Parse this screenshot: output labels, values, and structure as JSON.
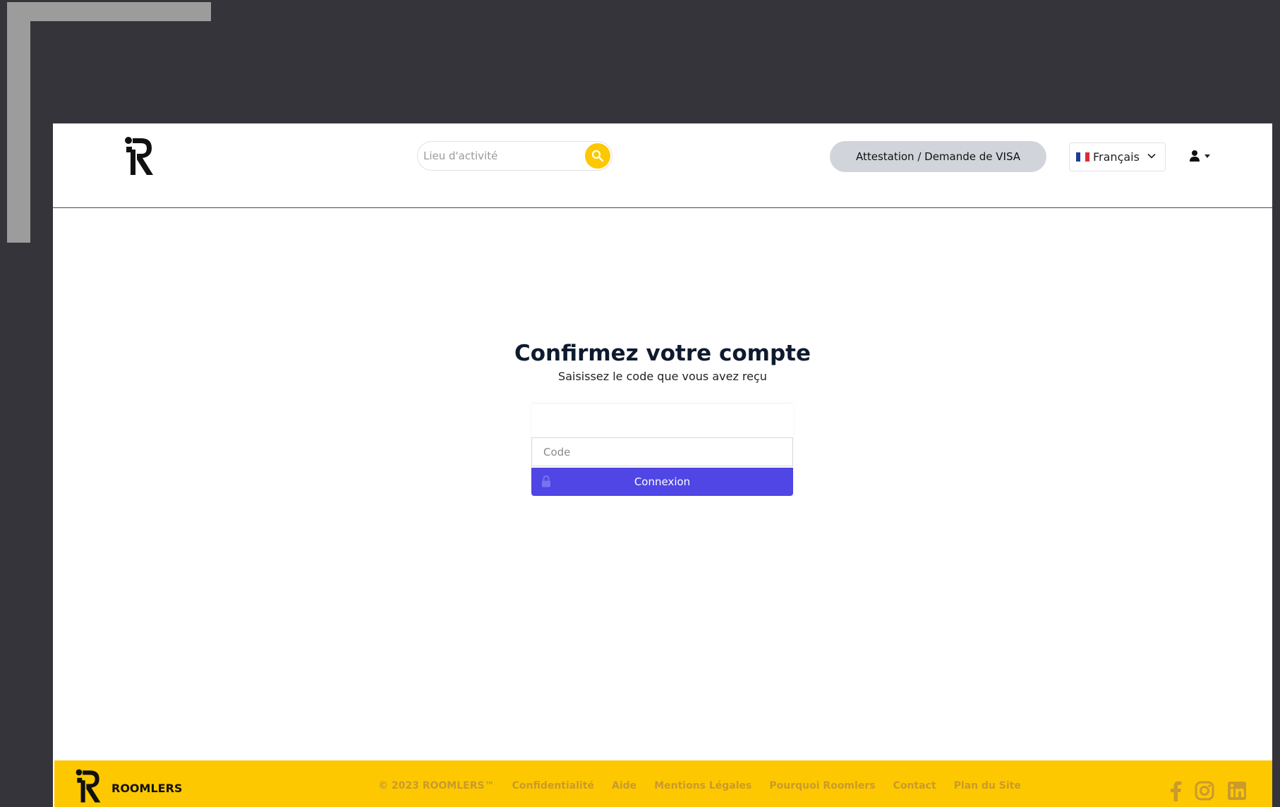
{
  "header": {
    "search_placeholder": "Lieu d'activité",
    "visa_button": "Attestation / Demande de VISA",
    "language": "Français"
  },
  "main": {
    "title": "Confirmez votre compte",
    "subtitle": "Saisissez le code que vous avez reçu",
    "code_placeholder": "Code",
    "submit_label": "Connexion"
  },
  "footer": {
    "brand": "ROOMLERS",
    "links": [
      "© 2023 ROOMLERS™",
      "Confidentialité",
      "Aide",
      "Mentions Légales",
      "Pourquoi Roomlers",
      "Contact",
      "Plan du Site"
    ],
    "socials": [
      "facebook-icon",
      "instagram-icon",
      "linkedin-icon"
    ]
  },
  "colors": {
    "accent_yellow": "#fdc800",
    "primary_button": "#4f46e5",
    "visa_button_bg": "#d1d5db",
    "desktop_bg": "#36343b",
    "footer_link": "#c99a2e"
  }
}
